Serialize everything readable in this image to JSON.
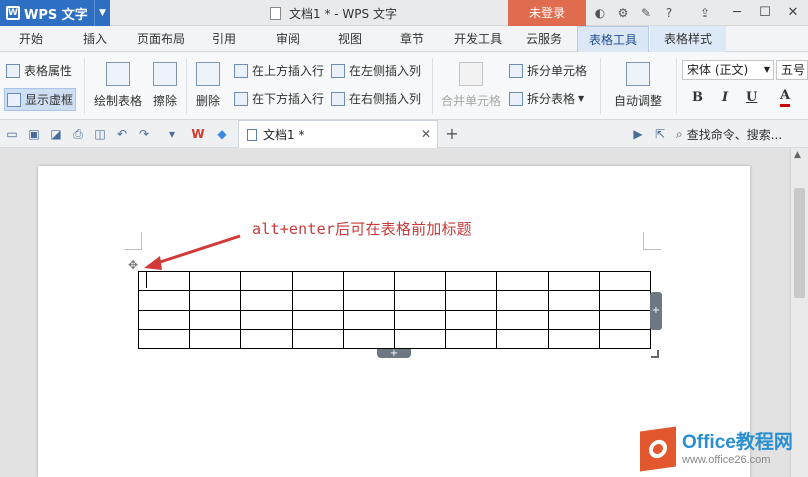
{
  "app": {
    "name": "WPS 文字"
  },
  "window": {
    "title": "文档1 * - WPS 文字",
    "login_label": "未登录",
    "help_icon": "?"
  },
  "menu_tabs": [
    "开始",
    "插入",
    "页面布局",
    "引用",
    "审阅",
    "视图",
    "章节",
    "开发工具",
    "云服务",
    "表格工具",
    "表格样式"
  ],
  "active_tab": "表格工具",
  "ribbon": {
    "table_properties": "表格属性",
    "show_gridlines": "显示虚框",
    "draw_table": "绘制表格",
    "eraser": "擦除",
    "delete": "删除",
    "insert_above": "在上方插入行",
    "insert_below": "在下方插入行",
    "insert_left": "在左侧插入列",
    "insert_right": "在右侧插入列",
    "merge_cells": "合并单元格",
    "split_cells": "拆分单元格",
    "split_table": "拆分表格",
    "auto_fit": "自动调整",
    "font_name": "宋体 (正文)",
    "font_size": "五号",
    "bold": "B",
    "italic": "I",
    "underline": "U",
    "font_color": "A"
  },
  "quick_access": {
    "doc_tab_label": "文档1 *",
    "search_placeholder": "查找命令、搜索..."
  },
  "document": {
    "annotation": "alt+enter后可在表格前加标题",
    "table": {
      "rows": 4,
      "cols": 10
    }
  },
  "watermark": {
    "line1": "Office教程网",
    "line2": "www.office26.com"
  },
  "colors": {
    "accent_blue": "#2d6fc3",
    "login_orange": "#e06c4f",
    "annotation_red": "#c63b3b"
  }
}
